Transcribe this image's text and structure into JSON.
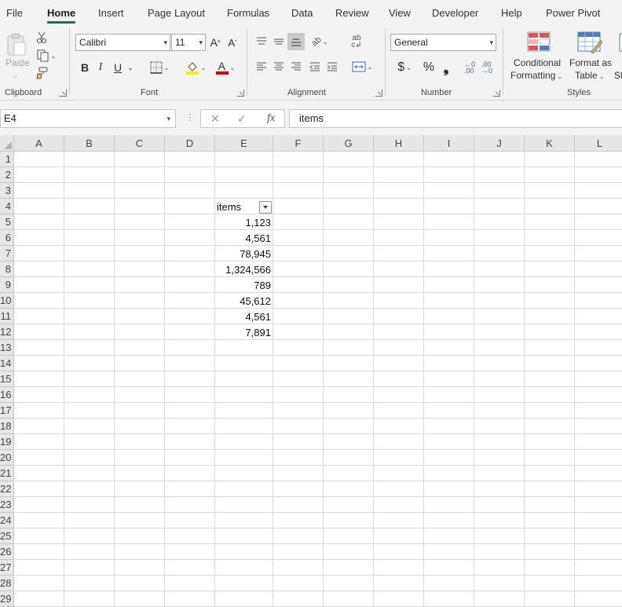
{
  "tabs": [
    "File",
    "Home",
    "Insert",
    "Page Layout",
    "Formulas",
    "Data",
    "Review",
    "View",
    "Developer",
    "Help",
    "Power Pivot"
  ],
  "active_tab": "Home",
  "ribbon": {
    "clipboard": {
      "paste_label": "Paste",
      "group_label": "Clipboard"
    },
    "font": {
      "font_name": "Calibri",
      "font_size": "11",
      "group_label": "Font",
      "bold": "B",
      "italic": "I",
      "underline": "U",
      "grow": "A˄",
      "shrink": "A˅",
      "font_color_letter": "A"
    },
    "alignment": {
      "group_label": "Alignment"
    },
    "number": {
      "format": "General",
      "group_label": "Number",
      "currency": "$",
      "percent": "%",
      "comma": "❟",
      "inc_decimal": ".00",
      "dec_decimal": ".00"
    },
    "styles": {
      "group_label": "Styles",
      "conditional_line1": "Conditional",
      "conditional_line2": "Formatting",
      "format_table_line1": "Format as",
      "format_table_line2": "Table",
      "cell_styles_partial": "St"
    }
  },
  "formula_bar": {
    "name_box": "E4",
    "cancel_icon": "✕",
    "enter_icon": "✓",
    "fx": "fx",
    "content": "items"
  },
  "columns": [
    "A",
    "B",
    "C",
    "D",
    "E",
    "F",
    "G",
    "H",
    "I",
    "J",
    "K",
    "L"
  ],
  "rows": [
    "1",
    "2",
    "3",
    "4",
    "5",
    "6",
    "7",
    "8",
    "9",
    "10",
    "11",
    "12",
    "13",
    "14",
    "15",
    "16",
    "17",
    "18",
    "19",
    "20",
    "21",
    "22",
    "23",
    "24",
    "25",
    "26",
    "27",
    "28",
    "29"
  ],
  "table": {
    "header": "items",
    "values": [
      "1,123",
      "4,561",
      "78,945",
      "1,324,566",
      "789",
      "45,612",
      "4,561",
      "7,891"
    ]
  },
  "colors": {
    "accent": "#217346",
    "ribbon_bg": "#f3f3f3",
    "header_bg": "#e6e6e6"
  }
}
